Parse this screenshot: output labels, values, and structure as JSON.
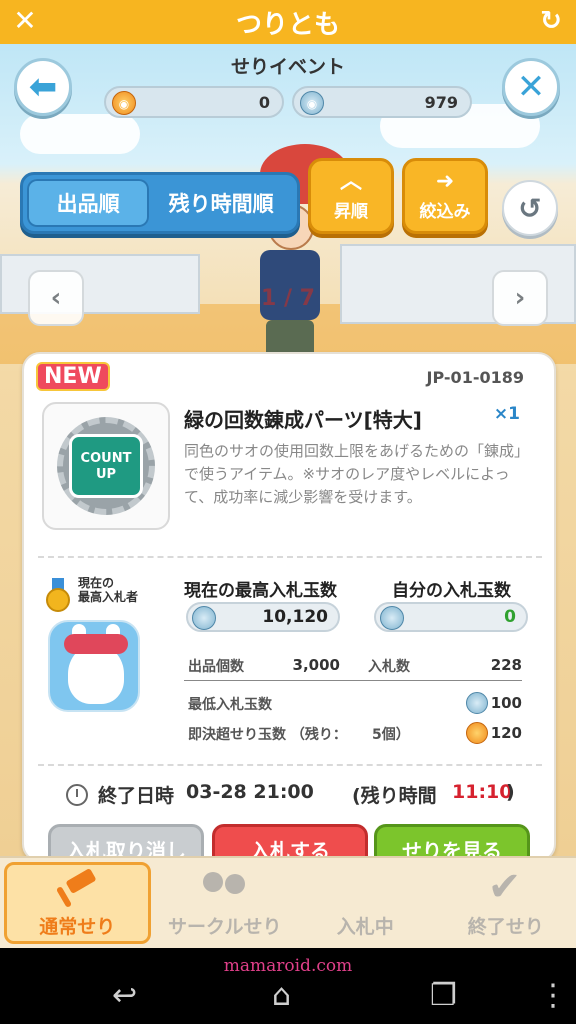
{
  "app": {
    "title": "つりとも"
  },
  "header": {
    "event_title": "せりイベント",
    "gold_coins": "0",
    "blue_coins": "979"
  },
  "sort": {
    "options": [
      "出品順",
      "残り時間順"
    ],
    "active_index": 0,
    "ascending_label": "昇順",
    "filter_label": "絞込み"
  },
  "pager": {
    "indicator": "1 / 7"
  },
  "item": {
    "badge": "NEW",
    "code": "JP-01-0189",
    "thumb_text_1": "COUNT",
    "thumb_text_2": "UP",
    "name": "緑の回数錬成パーツ[特大]",
    "quantity": "×1",
    "description": "同色のサオの使用回数上限をあげるための「錬成」で使うアイテム。※サオのレア度やレベルによって、成功率に減少影響を受けます。"
  },
  "bid": {
    "highest_bidder_label_1": "現在の",
    "highest_bidder_label_2": "最高入札者",
    "current_highest_label": "現在の最高入札玉数",
    "current_highest_value": "10,120",
    "my_bid_label": "自分の入札玉数",
    "my_bid_value": "0",
    "listing_count_label": "出品個数",
    "listing_count_value": "3,000",
    "bid_count_label": "入札数",
    "bid_count_value": "228",
    "min_bid_label": "最低入札玉数",
    "min_bid_value": "100",
    "buyout_label": "即決超せり玉数 （残り：",
    "buyout_remaining": "5個）",
    "buyout_value": "120"
  },
  "end": {
    "label": "終了日時",
    "datetime": "03-28 21:00",
    "remaining_label": "(残り時間",
    "remaining_value": "11:10",
    "remaining_close": ")"
  },
  "actions": {
    "cancel_label": "入札取り消し",
    "bid_label": "入札する",
    "view_label": "せりを見る"
  },
  "tabs": [
    {
      "label": "通常せり",
      "icon": "hammer-icon"
    },
    {
      "label": "サークルせり",
      "icon": "people-icon"
    },
    {
      "label": "入札中",
      "icon": "money-bag-icon"
    },
    {
      "label": "終了せり",
      "icon": "check-icon"
    }
  ],
  "watermark": "mamaroid.com",
  "colors": {
    "titlebar": "#f7b520",
    "sort_blue": "#3b95d6",
    "yellow_button": "#f9b626",
    "remaining_red": "#d6222f",
    "active_tab": "#ef7d1a"
  }
}
